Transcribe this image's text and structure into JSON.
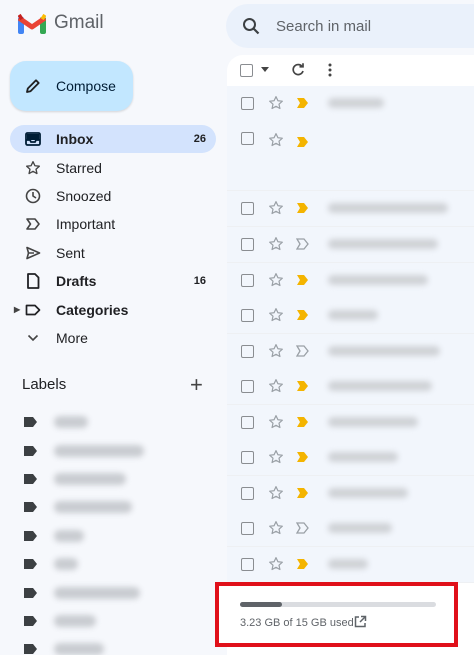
{
  "app": {
    "name": "Gmail"
  },
  "search": {
    "placeholder": "Search in mail"
  },
  "compose": {
    "label": "Compose"
  },
  "nav": [
    {
      "label": "Inbox",
      "count": "26",
      "icon": "inbox-icon"
    },
    {
      "label": "Starred",
      "count": "",
      "icon": "star-icon"
    },
    {
      "label": "Snoozed",
      "count": "",
      "icon": "clock-icon"
    },
    {
      "label": "Important",
      "count": "",
      "icon": "important-icon"
    },
    {
      "label": "Sent",
      "count": "",
      "icon": "send-icon"
    },
    {
      "label": "Drafts",
      "count": "16",
      "icon": "draft-icon"
    },
    {
      "label": "Categories",
      "count": "",
      "icon": "label-icon"
    },
    {
      "label": "More",
      "count": "",
      "icon": "chevron-down-icon"
    }
  ],
  "labels": {
    "title": "Labels",
    "add_icon": "plus-icon"
  },
  "storage": {
    "text": "3.23 GB of 15 GB used",
    "used_fraction": 0.215
  },
  "colors": {
    "accent": "#0b57d0",
    "compose_bg": "#c2e7ff",
    "active_nav": "#d3e3fd",
    "important": "#f4b400",
    "highlight_box": "#e0101a"
  }
}
